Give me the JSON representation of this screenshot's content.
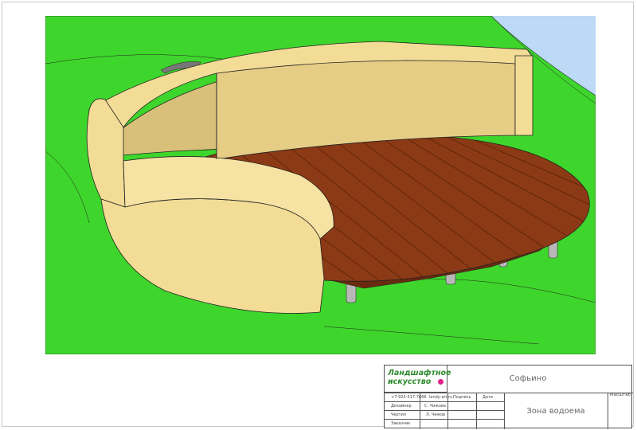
{
  "title_block": {
    "logo_line1": "Ландшафтное",
    "logo_line2": "искусство",
    "contact_phone": "+7-925-517-7666",
    "contact_site": "landy-art.ru",
    "project_name": "Софьино",
    "sheet_title": "Зона водоема",
    "scale_label": "Масштаб",
    "col_signature": "Подпись",
    "col_date": "Дата",
    "role_designer": "Дизайнер",
    "name_designer": "С. Чижова",
    "role_drafter": "Чертил",
    "name_drafter": "Л. Чижов",
    "role_customer": "Заказчик",
    "name_customer": ""
  },
  "colors": {
    "grass": "#3ed62c",
    "wall": "#f2dc96",
    "deck": "#8b3a15",
    "sky": "#bcd9f5",
    "post": "#b8b8b8"
  }
}
